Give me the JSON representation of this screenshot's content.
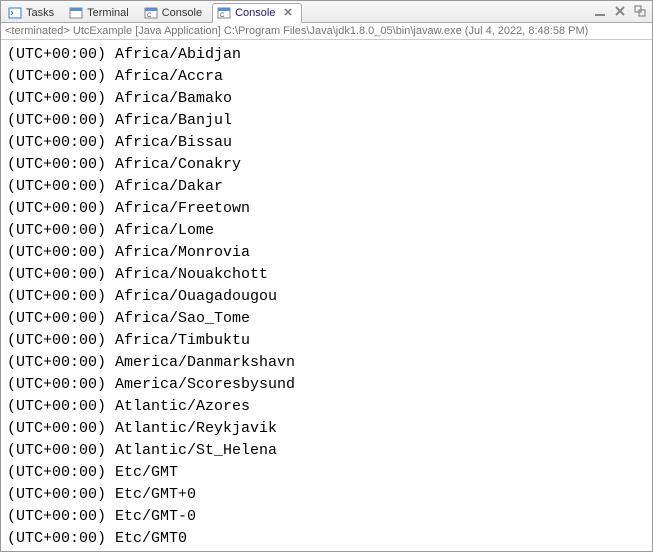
{
  "tabs": [
    {
      "label": "Tasks",
      "icon": "tasks"
    },
    {
      "label": "Terminal",
      "icon": "terminal"
    },
    {
      "label": "Console",
      "icon": "console"
    },
    {
      "label": "Console",
      "icon": "console",
      "active": true,
      "closable": true
    }
  ],
  "toolbar": {
    "minimize": "minimize",
    "maximize": "maximize"
  },
  "status": "<terminated> UtcExample [Java Application] C:\\Program Files\\Java\\jdk1.8.0_05\\bin\\javaw.exe (Jul 4, 2022, 8:48:58 PM)",
  "output": [
    "(UTC+00:00) Africa/Abidjan",
    "(UTC+00:00) Africa/Accra",
    "(UTC+00:00) Africa/Bamako",
    "(UTC+00:00) Africa/Banjul",
    "(UTC+00:00) Africa/Bissau",
    "(UTC+00:00) Africa/Conakry",
    "(UTC+00:00) Africa/Dakar",
    "(UTC+00:00) Africa/Freetown",
    "(UTC+00:00) Africa/Lome",
    "(UTC+00:00) Africa/Monrovia",
    "(UTC+00:00) Africa/Nouakchott",
    "(UTC+00:00) Africa/Ouagadougou",
    "(UTC+00:00) Africa/Sao_Tome",
    "(UTC+00:00) Africa/Timbuktu",
    "(UTC+00:00) America/Danmarkshavn",
    "(UTC+00:00) America/Scoresbysund",
    "(UTC+00:00) Atlantic/Azores",
    "(UTC+00:00) Atlantic/Reykjavik",
    "(UTC+00:00) Atlantic/St_Helena",
    "(UTC+00:00) Etc/GMT",
    "(UTC+00:00) Etc/GMT+0",
    "(UTC+00:00) Etc/GMT-0",
    "(UTC+00:00) Etc/GMT0"
  ]
}
